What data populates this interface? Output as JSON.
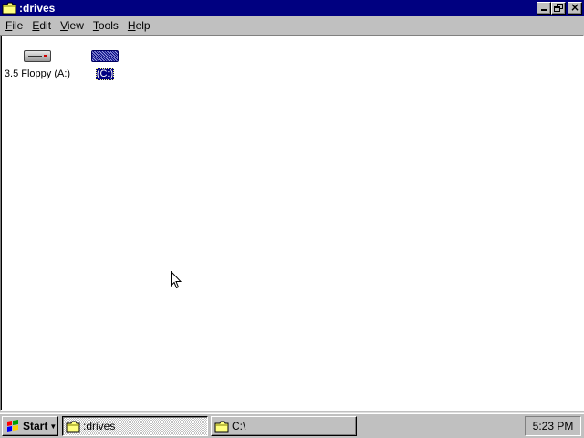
{
  "window": {
    "title": ":drives",
    "controls": {
      "minimize": "minimize",
      "maximize": "restore",
      "close": "close"
    }
  },
  "menu": {
    "items": [
      {
        "underline": "F",
        "rest": "ile"
      },
      {
        "underline": "E",
        "rest": "dit"
      },
      {
        "underline": "V",
        "rest": "iew"
      },
      {
        "underline": "T",
        "rest": "ools"
      },
      {
        "underline": "H",
        "rest": "elp"
      }
    ]
  },
  "drives": [
    {
      "label": "3.5 Floppy (A:)",
      "icon": "floppy-drive-icon",
      "selected": false
    },
    {
      "label": "(C:)",
      "icon": "hard-drive-icon",
      "selected": true
    }
  ],
  "taskbar": {
    "start_label": "Start",
    "tasks": [
      {
        "label": ":drives",
        "active": true
      },
      {
        "label": "C:\\",
        "active": false
      }
    ],
    "clock": "5:23 PM"
  },
  "colors": {
    "titlebar": "#000080",
    "face": "#c0c0c0",
    "selection": "#000080",
    "folder": "#ffff80"
  }
}
